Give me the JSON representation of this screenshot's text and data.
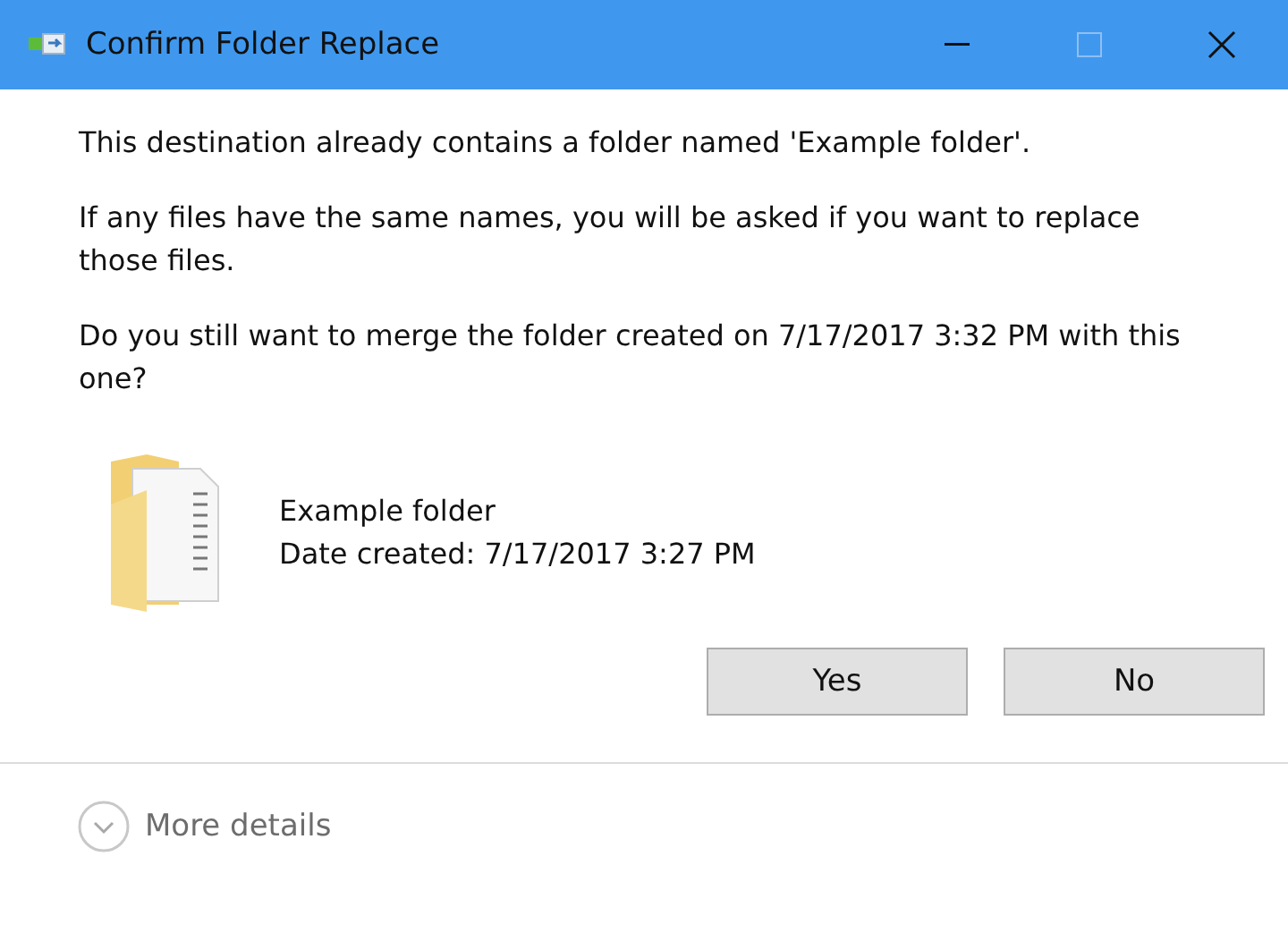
{
  "window": {
    "title": "Confirm Folder Replace",
    "maximize_disabled": true
  },
  "messages": [
    "This destination already contains a folder named 'Example folder'.",
    "If any files have the same names, you will be asked if you want to replace those files.",
    "Do you still want to merge the folder created on 7/17/2017 3:32 PM with this one?"
  ],
  "folder": {
    "name": "Example folder",
    "date": "Date created: 7/17/2017 3:27 PM"
  },
  "buttons": [
    "Yes",
    "No"
  ],
  "details": {
    "label": "More details",
    "expanded": false
  }
}
